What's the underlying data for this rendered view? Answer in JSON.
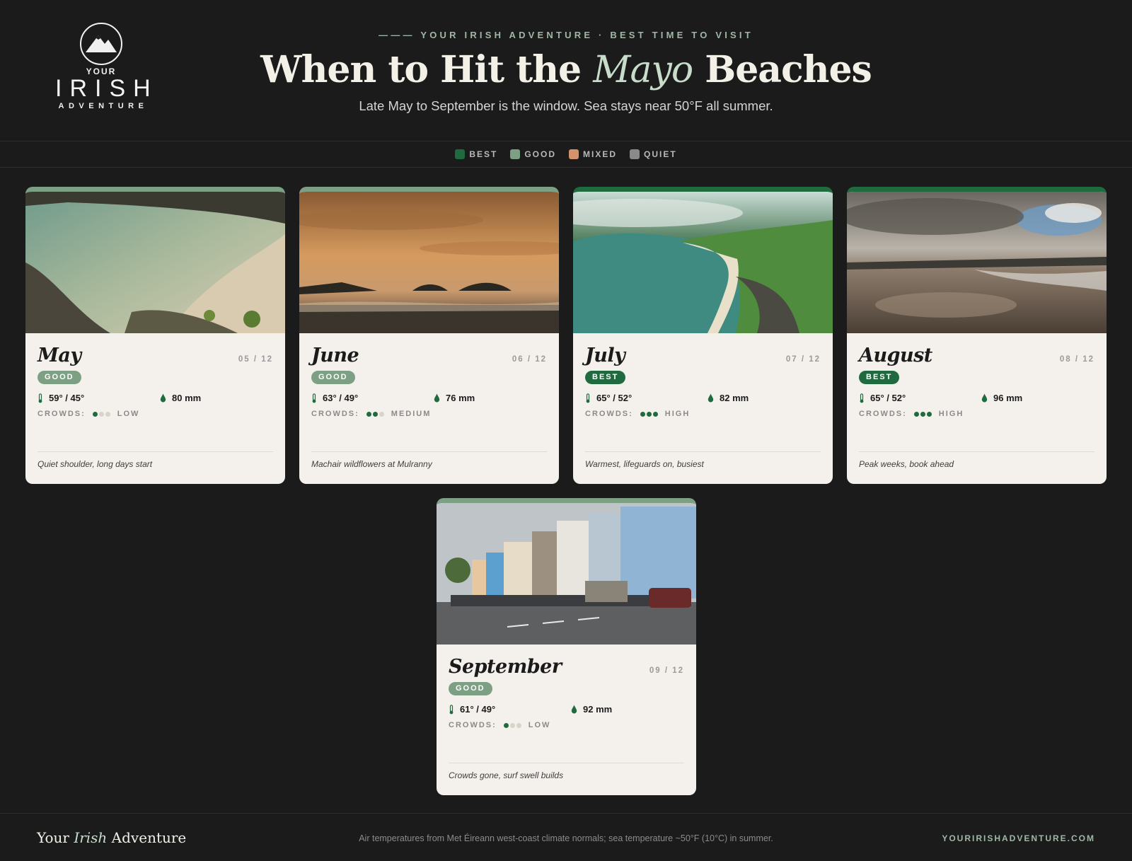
{
  "logo": {
    "your": "YOUR",
    "irish": "IRISH",
    "adventure": "ADVENTURE"
  },
  "header": {
    "eyebrow": "——— YOUR IRISH ADVENTURE · BEST TIME TO VISIT",
    "title_pre": "When to Hit the ",
    "title_accent": "Mayo",
    "title_post": " Beaches",
    "subtitle": "Late May to September is the window. Sea stays near 50°F all summer."
  },
  "legend": [
    {
      "label": "BEST",
      "color": "#1f6b3f"
    },
    {
      "label": "GOOD",
      "color": "#7d9f84"
    },
    {
      "label": "MIXED",
      "color": "#d4936a"
    },
    {
      "label": "QUIET",
      "color": "#8a8a8a"
    }
  ],
  "months": [
    {
      "name": "May",
      "index": "05 / 12",
      "rating": "GOOD",
      "temp": "59° / 45°",
      "rain": "80 mm",
      "crowds_label": "CROWDS:",
      "crowds_level": 1,
      "crowds": "LOW",
      "note": "Quiet shoulder, long days start"
    },
    {
      "name": "June",
      "index": "06 / 12",
      "rating": "GOOD",
      "temp": "63° / 49°",
      "rain": "76 mm",
      "crowds_label": "CROWDS:",
      "crowds_level": 2,
      "crowds": "MEDIUM",
      "note": "Machair wildflowers at Mulranny"
    },
    {
      "name": "July",
      "index": "07 / 12",
      "rating": "BEST",
      "temp": "65° / 52°",
      "rain": "82 mm",
      "crowds_label": "CROWDS:",
      "crowds_level": 3,
      "crowds": "HIGH",
      "note": "Warmest, lifeguards on, busiest"
    },
    {
      "name": "August",
      "index": "08 / 12",
      "rating": "BEST",
      "temp": "65° / 52°",
      "rain": "96 mm",
      "crowds_label": "CROWDS:",
      "crowds_level": 3,
      "crowds": "HIGH",
      "note": "Peak weeks, book ahead"
    },
    {
      "name": "September",
      "index": "09 / 12",
      "rating": "GOOD",
      "temp": "61° / 49°",
      "rain": "92 mm",
      "crowds_label": "CROWDS:",
      "crowds_level": 1,
      "crowds": "LOW",
      "note": "Crowds gone, surf swell builds"
    }
  ],
  "footer": {
    "brand_pre": "Your ",
    "brand_accent": "Irish",
    "brand_post": " Adventure",
    "source": "Air temperatures from Met Éireann west-coast climate normals; sea temperature ~50°F (10°C) in summer.",
    "site": "YOURIRISHADVENTURE.COM"
  }
}
